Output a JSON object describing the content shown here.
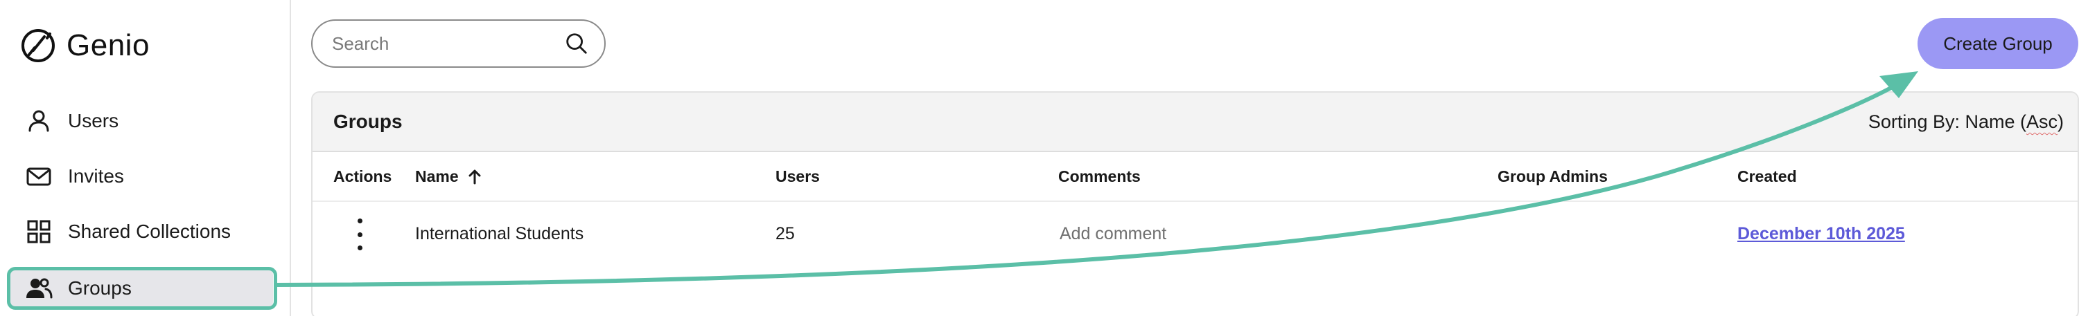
{
  "app": {
    "brand_name": "Genio"
  },
  "sidebar": {
    "items": [
      {
        "label": "Users",
        "icon": "user-icon"
      },
      {
        "label": "Invites",
        "icon": "mail-icon"
      },
      {
        "label": "Shared Collections",
        "icon": "grid-icon"
      },
      {
        "label": "Groups",
        "icon": "users-group-icon",
        "active": true
      }
    ]
  },
  "search": {
    "placeholder": "Search",
    "value": ""
  },
  "toolbar": {
    "create_label": "Create Group"
  },
  "groups_panel": {
    "title": "Groups",
    "sort_prefix": "Sorting By: Name (",
    "sort_dir": "Asc",
    "sort_suffix": ")",
    "columns": [
      "Actions",
      "Name",
      "Users",
      "Comments",
      "Group Admins",
      "Created"
    ],
    "rows": [
      {
        "name": "International Students",
        "users": "25",
        "comments": "Add comment",
        "group_admins": "",
        "created": "December 10th 2025"
      }
    ]
  },
  "colors": {
    "accent_button": "#9b98f4",
    "annotation": "#5bbfa7",
    "link": "#5d5ad8",
    "active_nav_bg": "#e6e6ea"
  }
}
